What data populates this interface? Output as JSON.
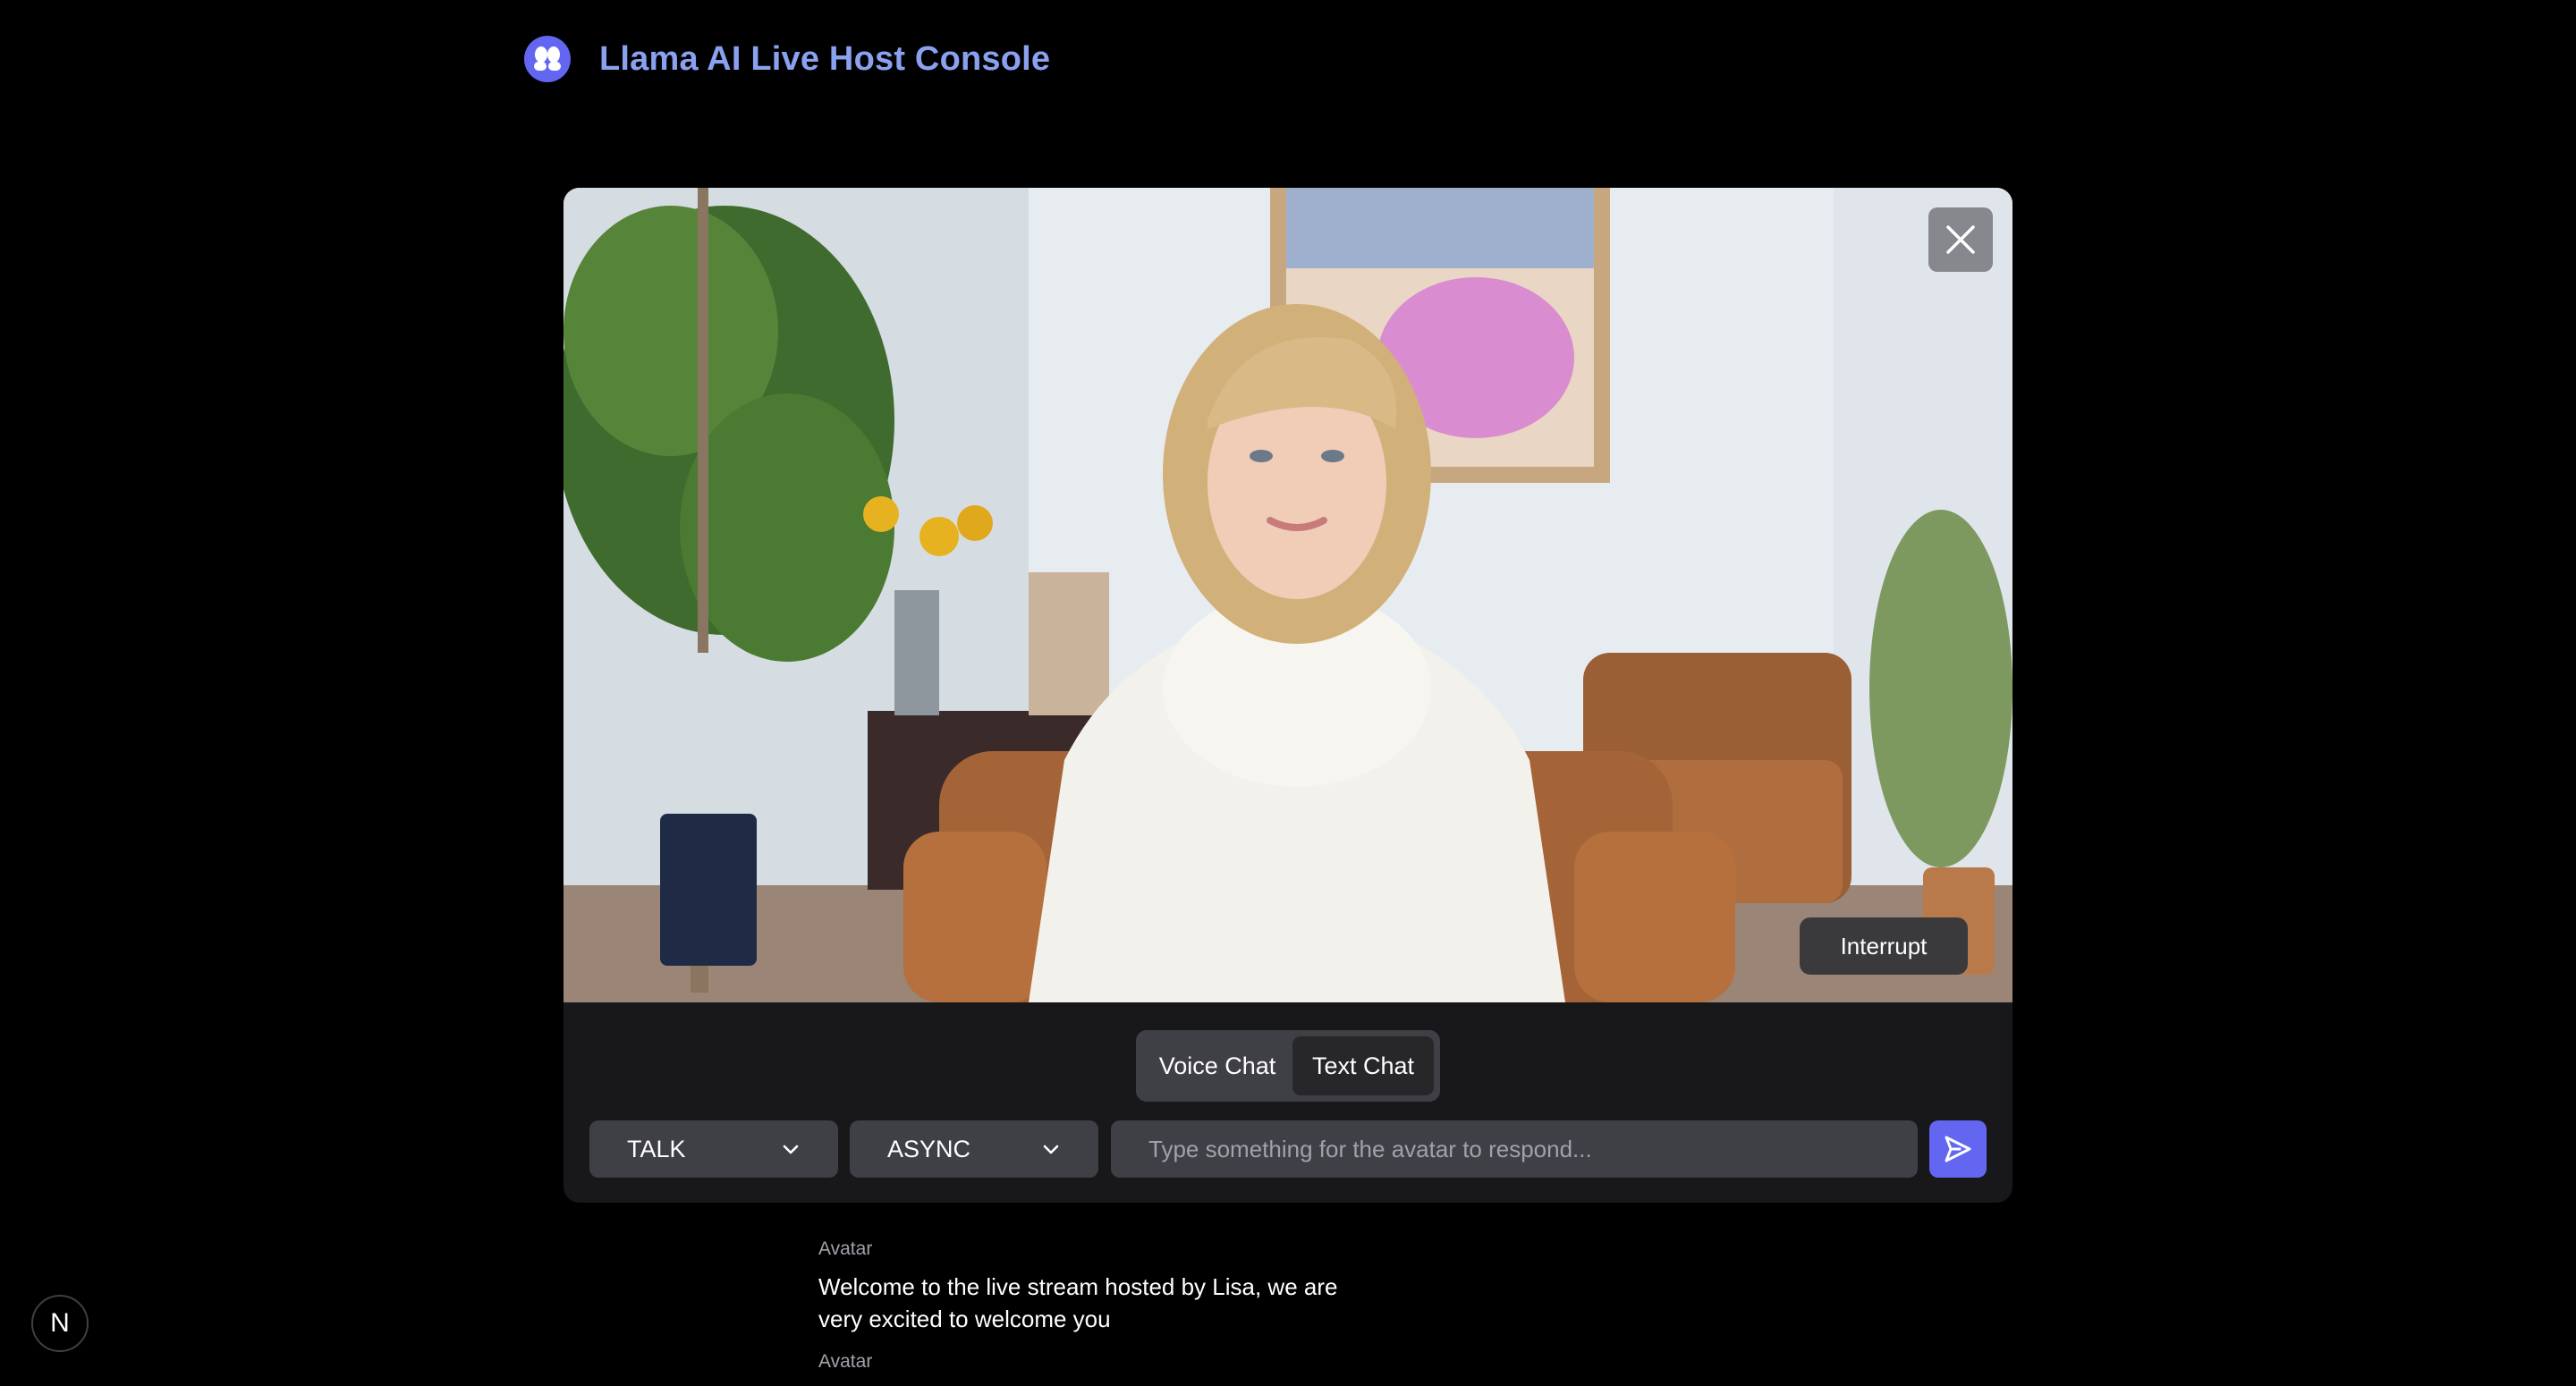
{
  "header": {
    "title": "Llama AI Live Host Console"
  },
  "video": {
    "close_icon": "close-icon",
    "interrupt_label": "Interrupt"
  },
  "mode_toggle": {
    "tabs": [
      {
        "label": "Voice Chat",
        "active": false
      },
      {
        "label": "Text Chat",
        "active": true
      }
    ]
  },
  "controls": {
    "task_type": {
      "value": "TALK",
      "icon": "chevron-down-icon"
    },
    "task_mode": {
      "value": "ASYNC",
      "icon": "chevron-down-icon"
    },
    "input": {
      "value": "",
      "placeholder": "Type something for the avatar to respond..."
    },
    "send_icon": "send-icon"
  },
  "messages": [
    {
      "sender": "Avatar",
      "text": "Welcome to the live stream hosted by Lisa, we are very excited to welcome you"
    },
    {
      "sender": "Avatar",
      "text": ""
    }
  ],
  "badge": {
    "label": "N"
  },
  "colors": {
    "accent": "#6366f1",
    "title": "#8aa1f0",
    "panel": "#18181b",
    "control": "#3f3f46"
  }
}
